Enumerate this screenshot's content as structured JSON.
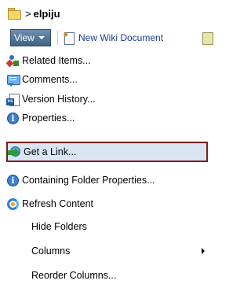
{
  "breadcrumb": {
    "separator": ">",
    "name": "elpiju"
  },
  "toolbar": {
    "view_label": "View",
    "new_wiki_label": "New Wiki Document"
  },
  "menu": {
    "items": [
      {
        "label": "Related Items...",
        "icon": "related-items-icon"
      },
      {
        "label": "Comments...",
        "icon": "comments-icon"
      },
      {
        "label": "Version History...",
        "icon": "version-history-icon"
      },
      {
        "label": "Properties...",
        "icon": "properties-icon"
      },
      {
        "label": "Get a Link...",
        "icon": "get-link-icon",
        "highlighted": true
      },
      {
        "label": "Containing Folder Properties...",
        "icon": "folder-properties-icon"
      },
      {
        "label": "Refresh Content",
        "icon": "refresh-icon"
      },
      {
        "label": "Hide Folders"
      },
      {
        "label": "Columns",
        "submenu": true
      },
      {
        "label": "Reorder Columns..."
      }
    ]
  },
  "colors": {
    "highlight_bg": "#d9e6f2",
    "highlight_border": "#7a1c1c",
    "view_button": "#4f7396",
    "link_text": "#1a3c8a"
  }
}
